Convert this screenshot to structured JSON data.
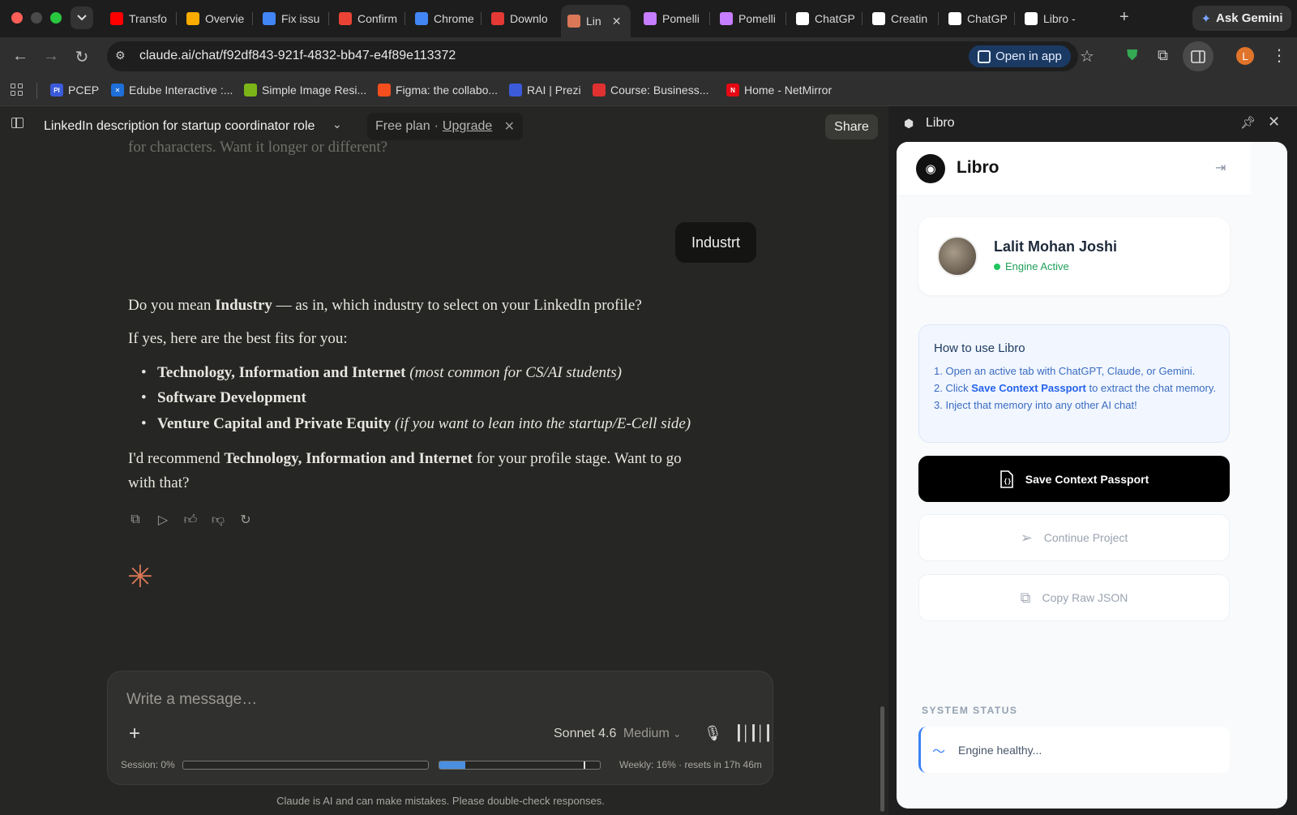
{
  "tabs": [
    {
      "label": "Transfo",
      "icon": "youtube-icon",
      "color": "#ff0000"
    },
    {
      "label": "Overvie",
      "icon": "analytics-icon",
      "color": "#f9ab00"
    },
    {
      "label": "Fix issu",
      "icon": "google-icon",
      "color": "#4285f4"
    },
    {
      "label": "Confirm",
      "icon": "gmail-icon",
      "color": "#ea4335"
    },
    {
      "label": "Chrome",
      "icon": "google-icon",
      "color": "#4285f4"
    },
    {
      "label": "Downlo",
      "icon": "heart-icon",
      "color": "#e53935"
    },
    {
      "label": "Lin",
      "icon": "claude-icon",
      "color": "#d97757",
      "active": true
    },
    {
      "label": "Pomelli",
      "icon": "pomelli-icon",
      "color": "#c77dff"
    },
    {
      "label": "Pomelli",
      "icon": "pomelli-icon",
      "color": "#c77dff"
    },
    {
      "label": "ChatGP",
      "icon": "chatgpt-icon",
      "color": "#ffffff"
    },
    {
      "label": "Creatin",
      "icon": "chatgpt-icon",
      "color": "#ffffff"
    },
    {
      "label": "ChatGP",
      "icon": "chatgpt-icon",
      "color": "#ffffff"
    },
    {
      "label": "Libro -",
      "icon": "libro-icon",
      "color": "#ffffff"
    }
  ],
  "gemini": {
    "label": "Ask Gemini"
  },
  "address": {
    "url": "claude.ai/chat/f92df843-921f-4832-bb47-e4f89e113372",
    "open_in_app": "Open in app"
  },
  "profile_initial": "L",
  "bookmarks": [
    {
      "label": "PCEP",
      "color": "#3b5bdb",
      "badge": "PI"
    },
    {
      "label": "Edube Interactive :...",
      "color": "#1e6fd9",
      "badge": "✕"
    },
    {
      "label": "Simple Image Resi...",
      "color": "#7cb518",
      "badge": ""
    },
    {
      "label": "Figma: the collabo...",
      "color": "#f24e1e",
      "badge": ""
    },
    {
      "label": "RAI | Prezi",
      "color": "#3b5bdb",
      "badge": ""
    },
    {
      "label": "Course: Business...",
      "color": "#e03131",
      "badge": ""
    },
    {
      "label": "Home - NetMirror",
      "color": "#e50914",
      "badge": "N"
    }
  ],
  "chat": {
    "title": "LinkedIn description for startup coordinator role",
    "plan": "Free plan",
    "upgrade": "Upgrade",
    "share": "Share",
    "faded_prev": "for characters. Want it longer or different?",
    "user_msg": "Industrt",
    "resp_p1_pre": "Do you mean ",
    "resp_p1_bold": "Industry",
    "resp_p1_post": " — as in, which industry to select on your LinkedIn profile?",
    "resp_p2": "If yes, here are the best fits for you:",
    "bullets": [
      {
        "bold": "Technology, Information and Internet",
        "italic": " (most common for CS/AI students)"
      },
      {
        "bold": "Software Development",
        "italic": ""
      },
      {
        "bold": "Venture Capital and Private Equity",
        "italic": " (if you want to lean into the startup/E-Cell side)"
      }
    ],
    "resp_p3_pre": "I'd recommend ",
    "resp_p3_bold": "Technology, Information and Internet",
    "resp_p3_post": " for your profile stage. Want to go with that?",
    "placeholder": "Write a message…",
    "model": "Sonnet 4.6",
    "effort": "Medium",
    "session_label": "Session: 0%",
    "session_pct": 0,
    "weekly_label": "Weekly: 16% · resets in 17h 46m",
    "weekly_pct": 16,
    "disclaimer": "Claude is AI and can make mistakes. Please double-check responses."
  },
  "panel": {
    "title": "Libro",
    "app_name": "Libro",
    "user_name": "Lalit Mohan Joshi",
    "user_status": "Engine Active",
    "howto_title": "How to use Libro",
    "step1": "1. Open an active tab with ChatGPT, Claude, or Gemini.",
    "step2_pre": "2. Click ",
    "step2_bold": "Save Context Passport",
    "step2_post": " to extract the chat memory.",
    "step3": "3. Inject that memory into any other AI chat!",
    "save_btn": "Save Context Passport",
    "continue_btn": "Continue Project",
    "copy_btn": "Copy Raw JSON",
    "system_label": "SYSTEM STATUS",
    "system_status": "Engine healthy..."
  }
}
